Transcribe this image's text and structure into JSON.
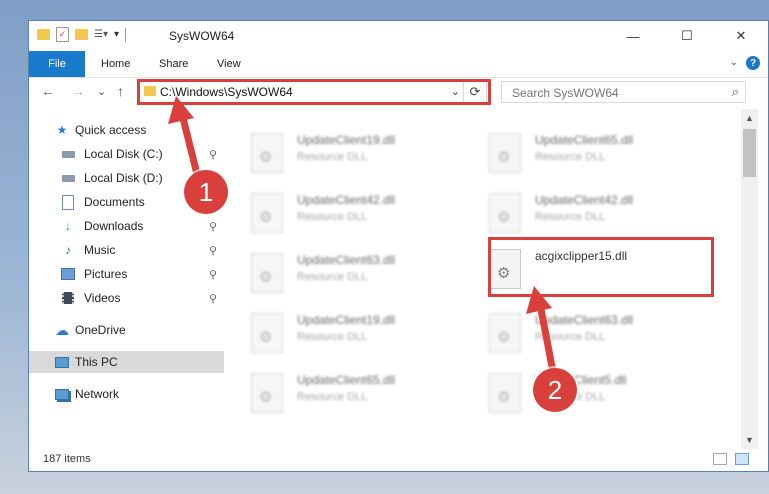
{
  "window": {
    "title": "SysWOW64",
    "controls": {
      "minimize": "—",
      "maximize": "☐",
      "close": "✕"
    }
  },
  "ribbon": {
    "tabs": [
      "File",
      "Home",
      "Share",
      "View"
    ],
    "help": "?",
    "expand": "⌄"
  },
  "nav": {
    "back": "←",
    "forward": "→",
    "recent": "⌄",
    "up": "↑",
    "address": "C:\\Windows\\SysWOW64",
    "address_dropdown": "⌄",
    "refresh": "⟳",
    "search_placeholder": "Search SysWOW64"
  },
  "sidebar": {
    "items": [
      {
        "label": "Quick access",
        "icon": "star-icon",
        "pinned": false
      },
      {
        "label": "Local Disk (C:)",
        "icon": "drive-icon",
        "pinned": true
      },
      {
        "label": "Local Disk (D:)",
        "icon": "drive-icon",
        "pinned": false
      },
      {
        "label": "Documents",
        "icon": "document-icon",
        "pinned": true
      },
      {
        "label": "Downloads",
        "icon": "download-icon",
        "pinned": true
      },
      {
        "label": "Music",
        "icon": "music-icon",
        "pinned": true
      },
      {
        "label": "Pictures",
        "icon": "pictures-icon",
        "pinned": true
      },
      {
        "label": "Videos",
        "icon": "video-icon",
        "pinned": true
      },
      {
        "label": "OneDrive",
        "icon": "cloud-icon",
        "pinned": false
      },
      {
        "label": "This PC",
        "icon": "computer-icon",
        "pinned": false,
        "selected": true
      },
      {
        "label": "Network",
        "icon": "network-icon",
        "pinned": false
      }
    ],
    "pin_glyph": "📌"
  },
  "files": [
    {
      "name": "UpdateClient19.dll",
      "type": "Resource DLL",
      "blurred": true
    },
    {
      "name": "UpdateClient65.dll",
      "type": "Resource DLL",
      "blurred": true
    },
    {
      "name": "UpdateClient42.dll",
      "type": "Resource DLL",
      "blurred": true
    },
    {
      "name": "UpdateClient42.dll",
      "type": "Resource DLL",
      "blurred": true
    },
    {
      "name": "UpdateClient63.dll",
      "type": "Resource DLL",
      "blurred": true
    },
    {
      "name": "acgixclipper15.dll",
      "type": "",
      "blurred": false
    },
    {
      "name": "UpdateClient19.dll",
      "type": "Resource DLL",
      "blurred": true
    },
    {
      "name": "UpdateClient63.dll",
      "type": "Resource DLL",
      "blurred": true
    },
    {
      "name": "UpdateClient65.dll",
      "type": "Resource DLL",
      "blurred": true
    },
    {
      "name": "UpdateClient5.dll",
      "type": "Resource DLL",
      "blurred": true
    }
  ],
  "status": {
    "item_count": "187 items"
  },
  "markers": {
    "step1": "1",
    "step2": "2"
  },
  "colors": {
    "accent": "#1979ca",
    "highlight": "#d9403c",
    "selection": "#d9d9d9"
  }
}
